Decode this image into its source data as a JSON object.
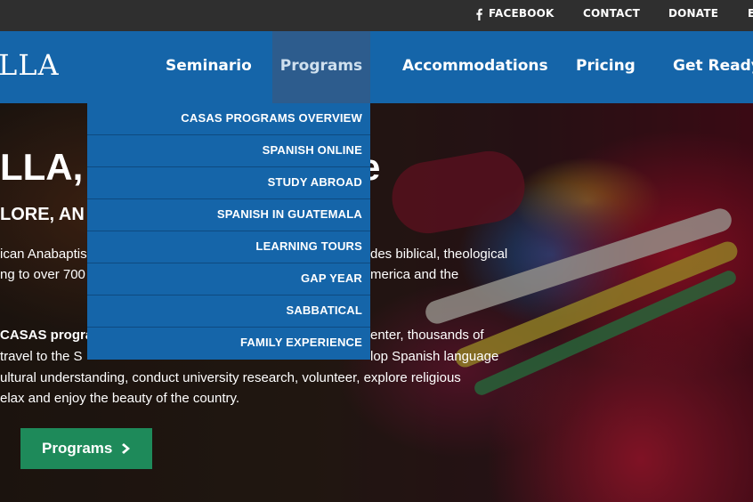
{
  "topbar": {
    "facebook_label": "FACEBOOK",
    "contact_label": "CONTACT",
    "donate_label": "DONATE",
    "cut_item_label": "E"
  },
  "navbar": {
    "logo_text": "LLA",
    "items": [
      {
        "label": "Seminario"
      },
      {
        "label": "Programs"
      },
      {
        "label": "Accommodations"
      },
      {
        "label": "Pricing"
      },
      {
        "label": "Get Ready"
      }
    ]
  },
  "dropdown": {
    "items": [
      {
        "label": "CASAS PROGRAMS OVERVIEW"
      },
      {
        "label": "SPANISH ONLINE"
      },
      {
        "label": "STUDY ABROAD"
      },
      {
        "label": "SPANISH IN GUATEMALA"
      },
      {
        "label": "LEARNING TOURS"
      },
      {
        "label": "GAP YEAR"
      },
      {
        "label": "SABBATICAL"
      },
      {
        "label": "FAMILY EXPERIENCE"
      }
    ]
  },
  "hero": {
    "title_visible": "LLA,",
    "title_tail": "e",
    "subtitle_visible": "LORE, AN",
    "para1_line1_left": "ican Anabaptis",
    "para1_line1_right": "des biblical, theological",
    "para1_line2_left": "ng to over 700",
    "para1_line2_right": "merica and the",
    "para2_line1_left": "CASAS progra",
    "para2_line1_right": "enter, thousands of",
    "para2_line2_left": " travel to the S",
    "para2_line2_right": "lop Spanish language",
    "para2_line3": "ultural understanding, conduct university research, volunteer, explore religious",
    "para2_line4": "elax and enjoy the beauty of the country.",
    "cta_label": "Programs"
  },
  "colors": {
    "topbar_bg": "#2f2f2f",
    "nav_bg": "#1565a9",
    "nav_active_bg": "#2d5c8d",
    "cta_bg": "#1e8a5a"
  }
}
